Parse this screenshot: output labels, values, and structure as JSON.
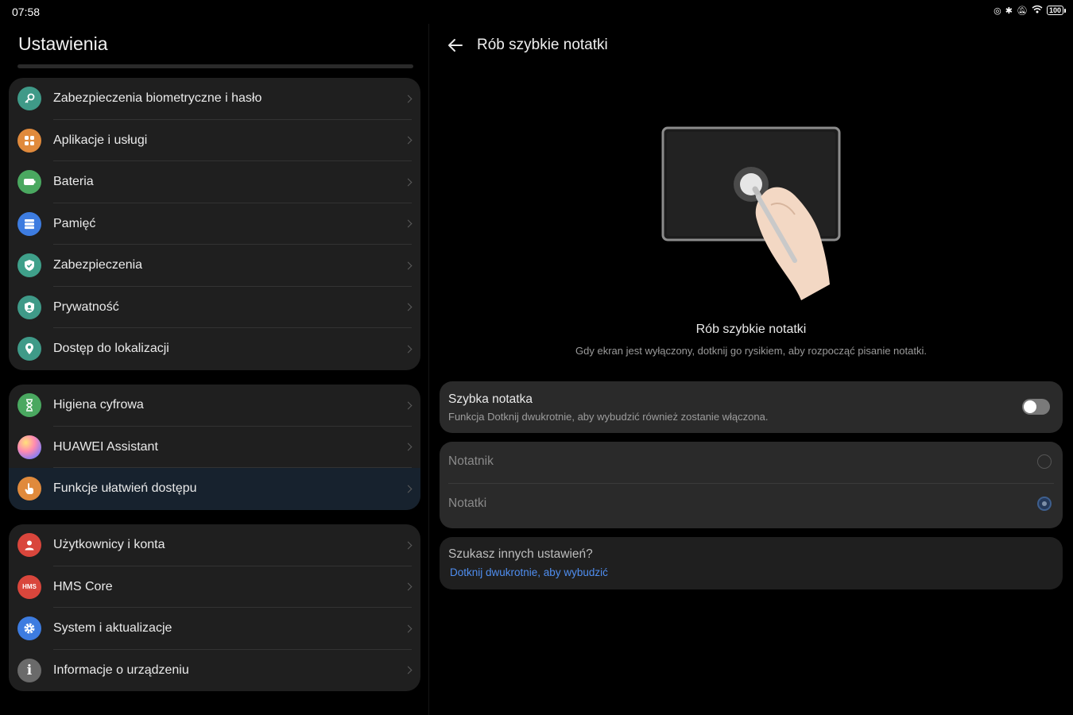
{
  "status_bar": {
    "time": "07:58",
    "battery": "100"
  },
  "left": {
    "title": "Ustawienia",
    "groups": [
      {
        "items": [
          {
            "label": "Zabezpieczenia biometryczne i hasło",
            "icon": "key-icon",
            "color": "#3f9a88"
          },
          {
            "label": "Aplikacje i usługi",
            "icon": "apps-icon",
            "color": "#e08a3c"
          },
          {
            "label": "Bateria",
            "icon": "battery-icon",
            "color": "#4aa860"
          },
          {
            "label": "Pamięć",
            "icon": "storage-icon",
            "color": "#3d7ce0"
          },
          {
            "label": "Zabezpieczenia",
            "icon": "shield-check-icon",
            "color": "#3fa08a"
          },
          {
            "label": "Prywatność",
            "icon": "privacy-shield-icon",
            "color": "#3f9a88"
          },
          {
            "label": "Dostęp do lokalizacji",
            "icon": "location-icon",
            "color": "#3f9a88"
          }
        ]
      },
      {
        "items": [
          {
            "label": "Higiena cyfrowa",
            "icon": "hourglass-icon",
            "color": "#4aa860"
          },
          {
            "label": "HUAWEI Assistant",
            "icon": "assistant-icon",
            "color": "#b17de0"
          },
          {
            "label": "Funkcje ułatwień dostępu",
            "icon": "hand-icon",
            "color": "#e08a3c"
          }
        ]
      },
      {
        "items": [
          {
            "label": "Użytkownicy i konta",
            "icon": "user-icon",
            "color": "#d9463c"
          },
          {
            "label": "HMS Core",
            "icon": "hms-icon",
            "color": "#d9463c",
            "icon_text": "HMS"
          },
          {
            "label": "System i aktualizacje",
            "icon": "gear-icon",
            "color": "#3d7ce0"
          },
          {
            "label": "Informacje o urządzeniu",
            "icon": "info-icon",
            "color": "#6a6a6a",
            "icon_text": "i"
          }
        ]
      }
    ]
  },
  "right": {
    "title": "Rób szybkie notatki",
    "feature_title": "Rób szybkie notatki",
    "feature_desc": "Gdy ekran jest wyłączony, dotknij go rysikiem, aby rozpocząć pisanie notatki.",
    "toggle_card": {
      "title": "Szybka notatka",
      "subtitle": "Funkcja Dotknij dwukrotnie, aby wybudzić również zostanie włączona.",
      "enabled": false
    },
    "options": [
      {
        "label": "Notatnik",
        "selected": false
      },
      {
        "label": "Notatki",
        "selected": true
      }
    ],
    "more": {
      "title": "Szukasz innych ustawień?",
      "link": "Dotknij dwukrotnie, aby wybudzić"
    }
  }
}
